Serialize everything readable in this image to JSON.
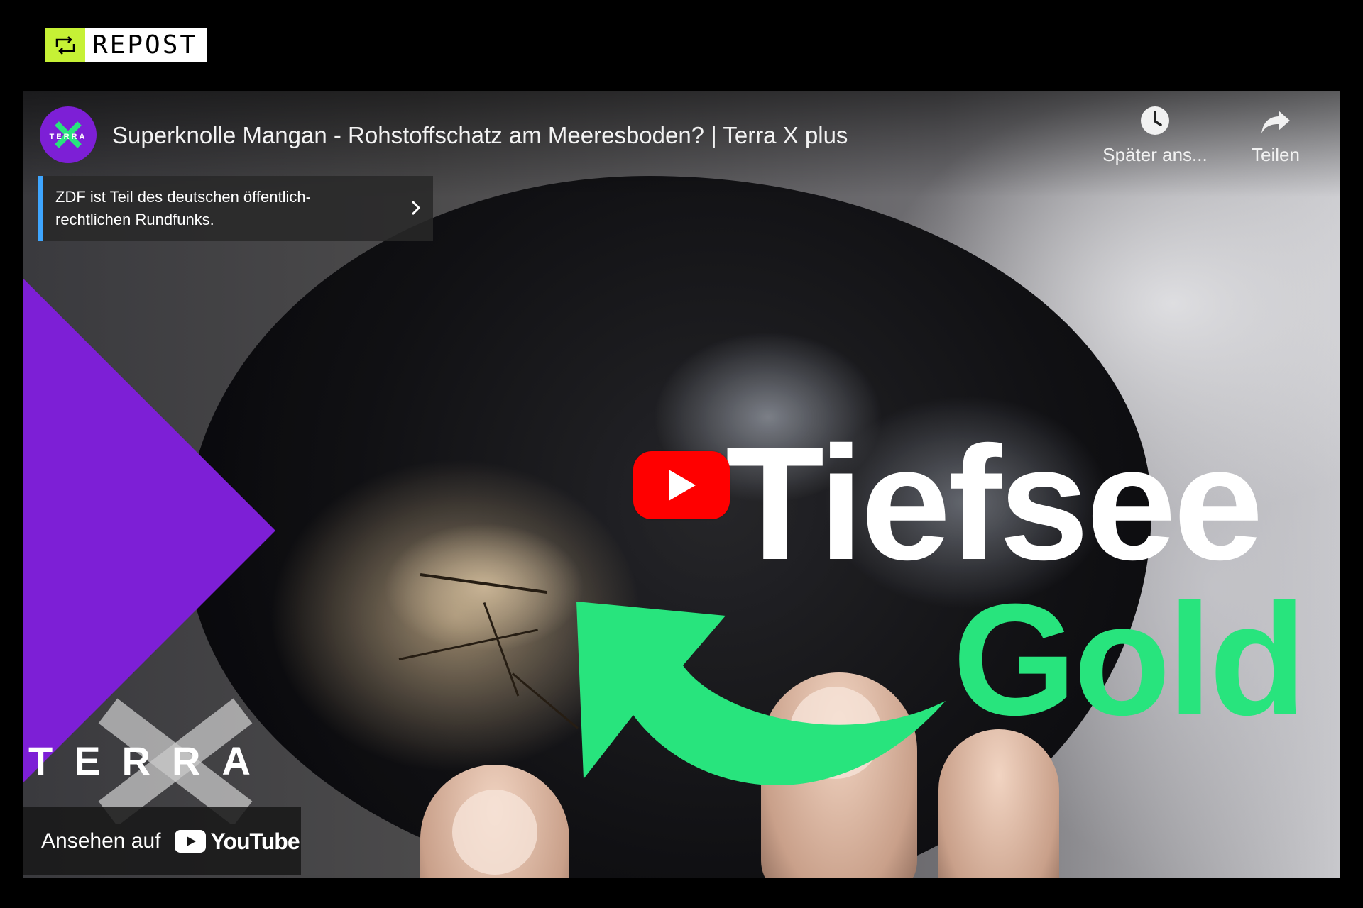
{
  "repost": {
    "label": "REPOST",
    "accent": "#c6f135"
  },
  "video": {
    "title": "Superknolle Mangan - Rohstoffschatz am Meeresboden? | Terra X plus",
    "channel": {
      "avatar_text": "TERRA",
      "avatar_color": "#7d1fd6"
    },
    "watch_later_label": "Später ans...",
    "share_label": "Teilen",
    "info_panel": {
      "text": "ZDF ist Teil des deutschen öffentlich-rechtlichen Rundfunks.",
      "accent": "#3ea6ff"
    },
    "thumbnail": {
      "word1": "Tiefsee",
      "word2": "Gold",
      "word2_color": "#28e47d",
      "brand_text": "TERRA"
    },
    "watch_on": {
      "label": "Ansehen auf",
      "platform": "YouTube"
    },
    "play_button_color": "#ff0000"
  }
}
